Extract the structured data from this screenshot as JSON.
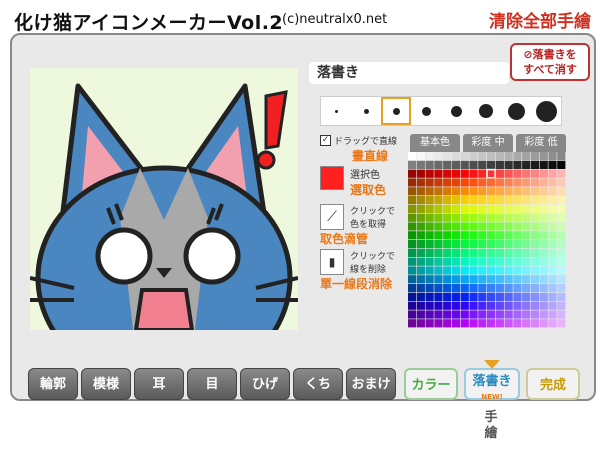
{
  "app": {
    "title": "化け猫アイコンメーカーVol.2",
    "copyright": "(c)neutralx0.net",
    "clear_all_label": "清除全部手繪"
  },
  "draw_panel": {
    "mode_label": "落書き",
    "clear_button": [
      "落書きを",
      "すべて消す"
    ],
    "sizes_selected_index": 2,
    "drag_line_checked": true,
    "drag_line_label": "ドラッグで直線",
    "drag_line_note": "畫直線",
    "selected_color": "#ff2020",
    "selected_color_label": "選択色",
    "selected_color_note": "選取色",
    "eyedropper_label": [
      "クリックで",
      "色を取得"
    ],
    "eyedropper_note": "取色滴管",
    "eraser_label": [
      "クリックで",
      "線を削除"
    ],
    "eraser_note": "單一線段消除"
  },
  "palette_tabs": [
    "基本色",
    "彩度 中",
    "彩度 低"
  ],
  "bottom_tabs": [
    "輪郭",
    "模様",
    "耳",
    "目",
    "ひげ",
    "くち",
    "おまけ",
    "カラー",
    "落書き",
    "完成"
  ],
  "new_badge": "NEW!",
  "tegaki_label": "手繪",
  "colors": {
    "accent_orange": "#e87818",
    "cat_blue": "#4a86c0",
    "cat_gray": "#a9a9a9",
    "ear_pink": "#f2a0ae",
    "canvas_bg": "#eef8dd"
  }
}
